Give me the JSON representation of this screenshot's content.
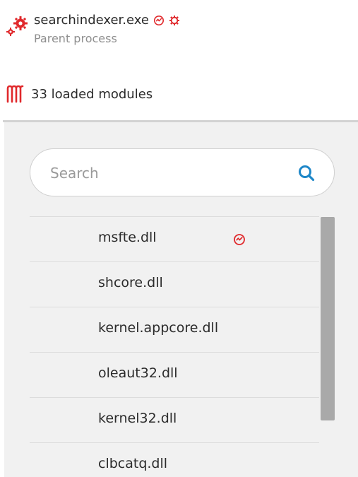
{
  "process": {
    "name": "searchindexer.exe",
    "subtitle": "Parent process",
    "icon": "gears-icon",
    "badges": [
      "signature-alert-icon",
      "settings-gear-icon"
    ]
  },
  "modules": {
    "count_label": "33 loaded modules",
    "icon": "modules-icon",
    "search": {
      "placeholder": "Search",
      "value": ""
    },
    "items": [
      {
        "name": "msfte.dll",
        "flag": "signature-alert-icon"
      },
      {
        "name": "shcore.dll"
      },
      {
        "name": "kernel.appcore.dll"
      },
      {
        "name": "oleaut32.dll"
      },
      {
        "name": "kernel32.dll"
      },
      {
        "name": "clbcatq.dll"
      }
    ],
    "scroll_fraction_visible": 0.78
  },
  "colors": {
    "accent_red": "#e0282b",
    "search_blue": "#1e87c8",
    "panel_bg": "#f1f1f1",
    "scrollbar": "#a9a9a9"
  }
}
